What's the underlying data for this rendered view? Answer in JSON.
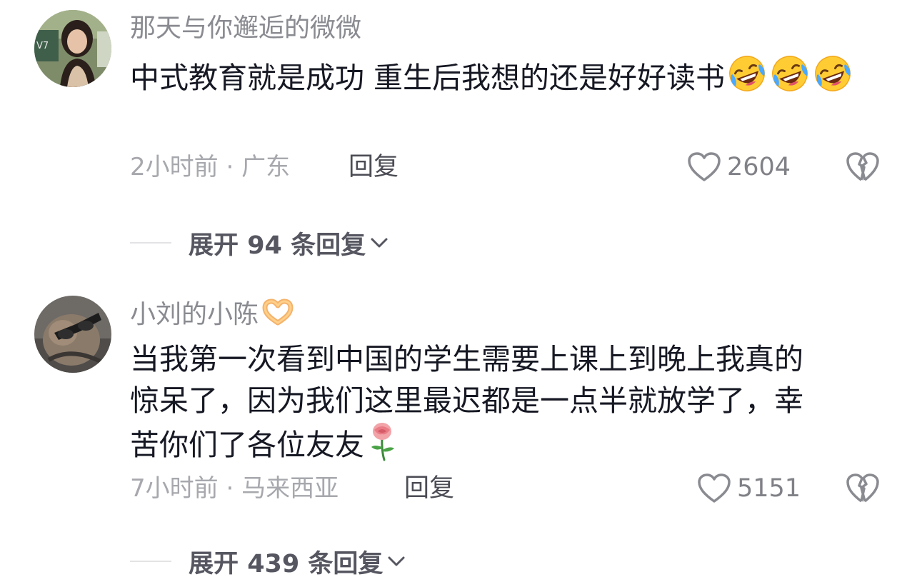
{
  "comments": [
    {
      "username": "那天与你邂逅的微微",
      "text": "中式教育就是成功 重生后我想的还是好好读书",
      "text_emoji": [
        "rofl-emoji",
        "rofl-emoji",
        "rofl-emoji"
      ],
      "time": "2小时前",
      "separator": "·",
      "location": "广东",
      "reply_label": "回复",
      "likes": "2604",
      "expand_prefix": "展开 ",
      "expand_count": "94",
      "expand_suffix": " 条回复"
    },
    {
      "username": "小刘的小陈",
      "username_emoji": "heart-hands-emoji",
      "text_line1": "当我第一次看到中国的学生需要上课上到晚上我真的",
      "text_line2": "惊呆了，因为我们这里最迟都是一点半就放学了，幸",
      "text_line3": "苦你们了各位友友",
      "text_emoji": [
        "rose-emoji"
      ],
      "time": "7小时前",
      "separator": "·",
      "location": "马来西亚",
      "reply_label": "回复",
      "likes": "5151",
      "expand_prefix": "展开 ",
      "expand_count": "439",
      "expand_suffix": " 条回复"
    }
  ],
  "colors": {
    "username": "#8a8b91",
    "text": "#161823",
    "meta": "#a7a8ad",
    "reply": "#4b4c54",
    "expand": "#555660"
  }
}
